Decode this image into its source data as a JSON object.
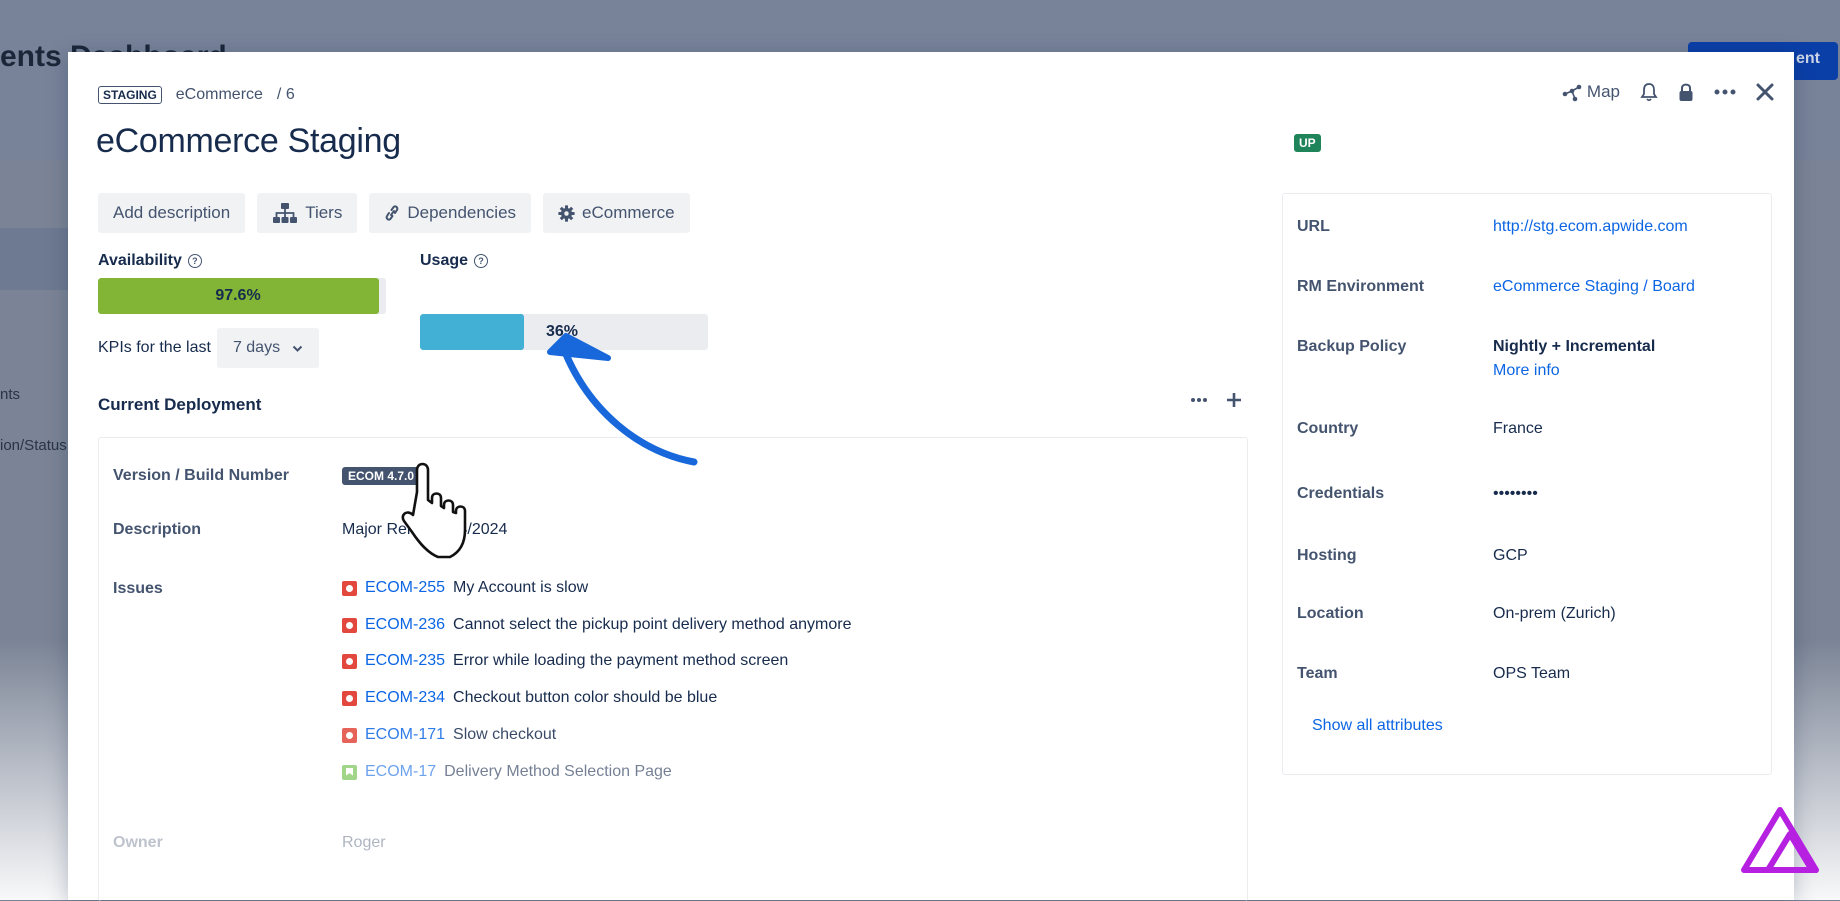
{
  "background": {
    "title": "ents Dashboard",
    "button_label": "ent",
    "text1": "nts",
    "text2": "ion/Status"
  },
  "breadcrumb": {
    "env_tag": "STAGING",
    "project": "eCommerce",
    "separator": "/",
    "number": "6"
  },
  "title": "eCommerce Staging",
  "status_badge": "UP",
  "header_actions": {
    "map_label": "Map"
  },
  "actions": {
    "add_description": "Add description",
    "tiers": "Tiers",
    "dependencies": "Dependencies",
    "category": "eCommerce"
  },
  "kpis": {
    "availability_label": "Availability",
    "availability_value": "97.6%",
    "availability_percent": 97.6,
    "usage_label": "Usage",
    "usage_value": "36%",
    "usage_percent": 36,
    "period_label": "KPIs for the last",
    "period_value": "7 days"
  },
  "deployment": {
    "section_title": "Current Deployment",
    "version_label": "Version / Build Number",
    "version_value": "ECOM 4.7.0",
    "description_label": "Description",
    "description_value": "Major Release 04/2024",
    "issues_label": "Issues",
    "issues": [
      {
        "key": "ECOM-255",
        "summary": "My Account is slow",
        "type": "bug"
      },
      {
        "key": "ECOM-236",
        "summary": "Cannot select the pickup point delivery method anymore",
        "type": "bug"
      },
      {
        "key": "ECOM-235",
        "summary": "Error while loading the payment method screen",
        "type": "bug"
      },
      {
        "key": "ECOM-234",
        "summary": "Checkout button color should be blue",
        "type": "bug"
      },
      {
        "key": "ECOM-171",
        "summary": "Slow checkout",
        "type": "bug"
      },
      {
        "key": "ECOM-17",
        "summary": "Delivery Method Selection Page",
        "type": "story"
      }
    ],
    "owner_label": "Owner",
    "owner_value": "Roger"
  },
  "attributes": {
    "url_label": "URL",
    "url_value": "http://stg.ecom.apwide.com",
    "rm_label": "RM Environment",
    "rm_value": "eCommerce Staging",
    "rm_sep": "/",
    "rm_board": "Board",
    "backup_label": "Backup Policy",
    "backup_value": "Nightly + Incremental",
    "backup_more": "More info",
    "country_label": "Country",
    "country_value": "France",
    "credentials_label": "Credentials",
    "credentials_value": "••••••••",
    "hosting_label": "Hosting",
    "hosting_value": "GCP",
    "location_label": "Location",
    "location_value": "On-prem (Zurich)",
    "team_label": "Team",
    "team_value": "OPS Team",
    "show_all": "Show all attributes"
  },
  "colors": {
    "availability_fill": "#82b536",
    "usage_fill": "#42b0d5",
    "link": "#0c66e4",
    "status_up": "#1f845a",
    "annotation_arrow": "#1868db",
    "brand_logo": "#b620e0"
  }
}
